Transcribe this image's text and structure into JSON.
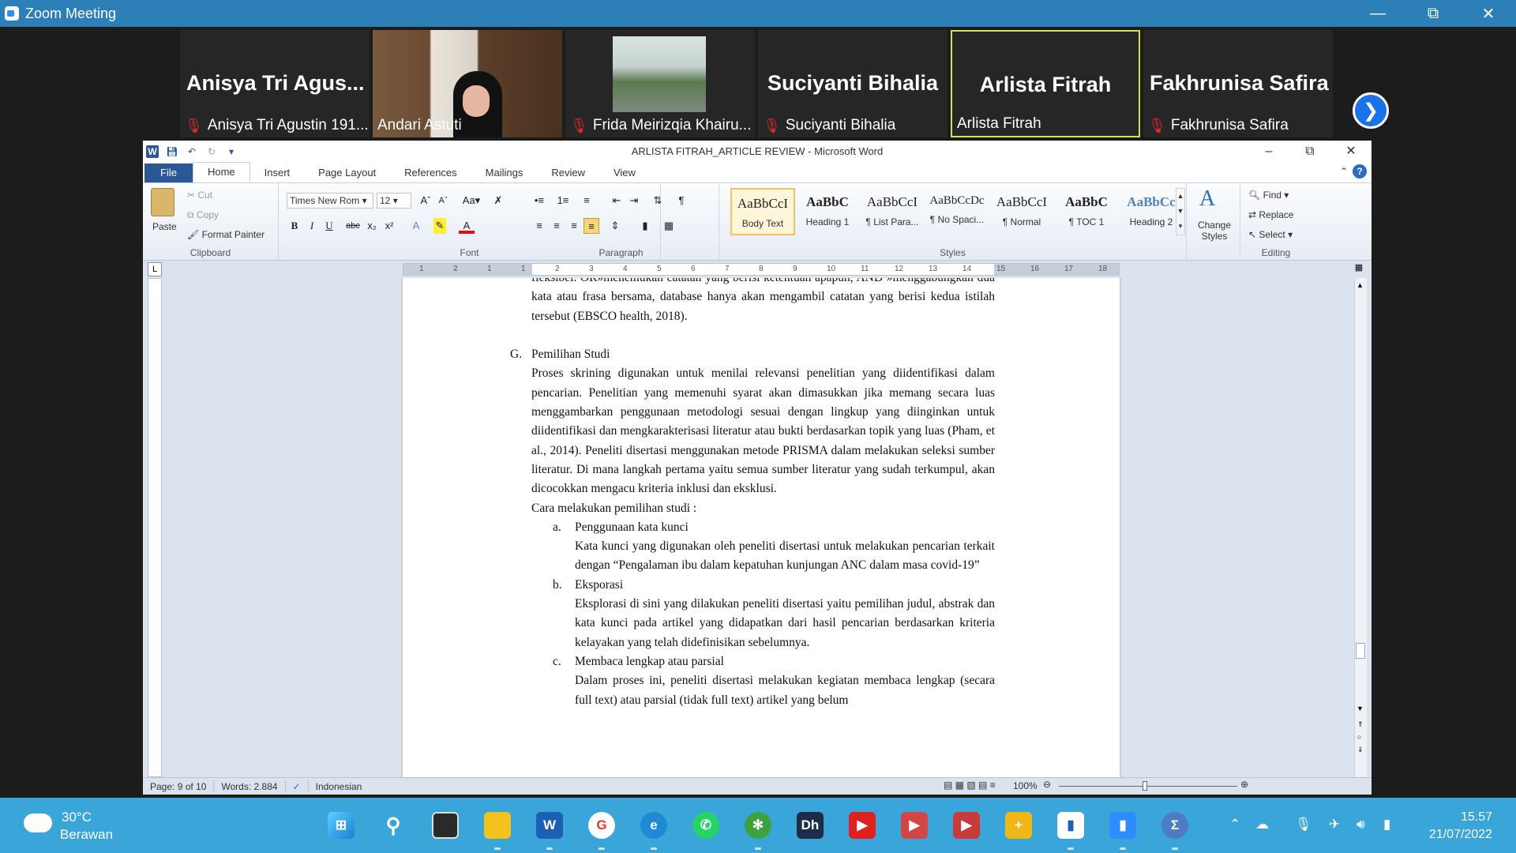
{
  "zoom": {
    "title": "Zoom Meeting",
    "participants": [
      {
        "display": "Anisya  Tri  Agus...",
        "label": "Anisya Tri Agustin 191...",
        "muted": true,
        "video": false
      },
      {
        "display": "",
        "label": "Andari Astuti",
        "muted": false,
        "video": true
      },
      {
        "display": "",
        "label": "Frida Meirizqia Khairu...",
        "muted": true,
        "video": true
      },
      {
        "display": "Suciyanti Bihalia",
        "label": "Suciyanti Bihalia",
        "muted": true,
        "video": false
      },
      {
        "display": "Arlista Fitrah",
        "label": "Arlista Fitrah",
        "muted": false,
        "video": false,
        "active": true
      },
      {
        "display": "Fakhrunisa Safira",
        "label": "Fakhrunisa Safira",
        "muted": true,
        "video": false
      }
    ]
  },
  "word": {
    "title": "ARLISTA FITRAH_ARTICLE REVIEW  -  Microsoft Word",
    "tabs": [
      "File",
      "Home",
      "Insert",
      "Page Layout",
      "References",
      "Mailings",
      "Review",
      "View"
    ],
    "clipboard": {
      "paste": "Paste",
      "cut": "Cut",
      "copy": "Copy",
      "format_painter": "Format Painter",
      "group": "Clipboard"
    },
    "font": {
      "name": "Times New Rom",
      "size": "12",
      "group": "Font"
    },
    "paragraph": {
      "group": "Paragraph"
    },
    "styles": {
      "group": "Styles",
      "items": [
        {
          "sample": "AaBbCcI",
          "name": "Body Text",
          "selected": true
        },
        {
          "sample": "AaBbC",
          "name": "Heading 1"
        },
        {
          "sample": "AaBbCcI",
          "name": "¶ List Para..."
        },
        {
          "sample": "AaBbCcDc",
          "name": "¶ No Spaci..."
        },
        {
          "sample": "AaBbCcI",
          "name": "¶ Normal"
        },
        {
          "sample": "AaBbC",
          "name": "¶ TOC 1"
        },
        {
          "sample": "AaBbCc",
          "name": "Heading 2"
        }
      ],
      "change": "Change Styles"
    },
    "editing": {
      "find": "Find",
      "replace": "Replace",
      "select": "Select",
      "group": "Editing"
    },
    "ruler_ticks": [
      "1",
      "2",
      "1",
      "1",
      "2",
      "3",
      "4",
      "5",
      "6",
      "7",
      "8",
      "9",
      "10",
      "11",
      "12",
      "13",
      "14",
      "15",
      "16",
      "17",
      "18"
    ],
    "document": {
      "p1": "fleksibel. OR»menemukan catatan yang berisi ketentuan apapun, AND »menggabungkan dua kata atau frasa bersama, database hanya akan mengambil catatan yang berisi kedua istilah tersebut (EBSCO health, 2018).",
      "heading_letter": "G.",
      "heading": "Pemilihan Studi",
      "p2": "Proses skrining digunakan untuk menilai relevansi penelitian yang diidentifikasi dalam pencarian. Penelitian yang memenuhi syarat akan dimasukkan jika memang secara luas menggambarkan penggunaan metodologi sesuai dengan lingkup yang diinginkan untuk diidentifikasi dan mengkarakterisasi literatur atau bukti berdasarkan topik yang luas (Pham, et al., 2014). Peneliti disertasi menggunakan metode PRISMA dalam melakukan seleksi sumber literatur. Di mana langkah pertama yaitu semua sumber literatur yang sudah terkumpul, akan dicocokkan mengacu kriteria inklusi dan eksklusi.",
      "p3": "Cara melakukan pemilihan studi :",
      "items": [
        {
          "letter": "a.",
          "title": "Penggunaan kata kunci",
          "body": "Kata kunci yang digunakan oleh peneliti disertasi untuk melakukan pencarian terkait dengan “Pengalaman ibu dalam kepatuhan kunjungan ANC dalam masa covid-19”"
        },
        {
          "letter": "b.",
          "title": "Eksporasi",
          "body": "Eksplorasi di sini yang dilakukan peneliti disertasi yaitu pemilihan judul, abstrak dan kata kunci pada artikel yang didapatkan dari hasil pencarian berdasarkan kriteria kelayakan yang telah didefinisikan sebelumnya."
        },
        {
          "letter": "c.",
          "title": "Membaca lengkap atau parsial",
          "body": "Dalam proses ini, peneliti disertasi melakukan kegiatan membaca lengkap (secara full text) atau parsial (tidak full text) artikel yang belum"
        }
      ]
    },
    "status": {
      "page": "Page: 9 of 10",
      "words": "Words: 2.884",
      "language": "Indonesian",
      "zoom": "100%"
    }
  },
  "taskbar": {
    "temp": "30°C",
    "weather": "Berawan",
    "time": "15.57",
    "date": "21/07/2022"
  }
}
